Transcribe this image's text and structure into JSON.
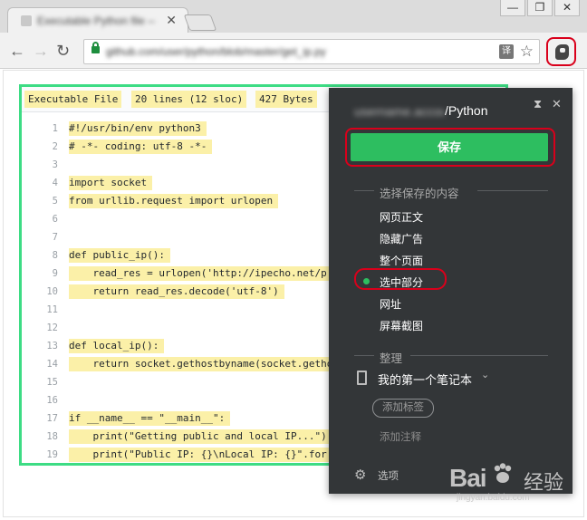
{
  "browser": {
    "tab_title": "Executable Python file — GitHub",
    "tab_close": "✕",
    "window_buttons": [
      "—",
      "❐",
      "✕"
    ],
    "nav": {
      "back": "←",
      "forward": "→",
      "reload": "↻"
    },
    "url": "github.com/user/python/blob/master/get_ip.py",
    "translate_icon": "译",
    "star_icon": "☆"
  },
  "code_view": {
    "meta": [
      "Executable File",
      "20 lines (12 sloc)",
      "427 Bytes"
    ],
    "lines": [
      {
        "n": "1",
        "text": "#!/usr/bin/env python3"
      },
      {
        "n": "2",
        "text": "# -*- coding: utf-8 -*-"
      },
      {
        "n": "3",
        "text": ""
      },
      {
        "n": "4",
        "text": "import socket"
      },
      {
        "n": "5",
        "text": "from urllib.request import urlopen"
      },
      {
        "n": "6",
        "text": ""
      },
      {
        "n": "7",
        "text": ""
      },
      {
        "n": "8",
        "text": "def public_ip():"
      },
      {
        "n": "9",
        "text": "    read_res = urlopen('http://ipecho.net/p"
      },
      {
        "n": "10",
        "text": "    return read_res.decode('utf-8')"
      },
      {
        "n": "11",
        "text": ""
      },
      {
        "n": "12",
        "text": ""
      },
      {
        "n": "13",
        "text": "def local_ip():"
      },
      {
        "n": "14",
        "text": "    return socket.gethostbyname(socket.getho"
      },
      {
        "n": "15",
        "text": ""
      },
      {
        "n": "16",
        "text": ""
      },
      {
        "n": "17",
        "text": "if __name__ == \"__main__\":"
      },
      {
        "n": "18",
        "text": "    print(\"Getting public and local IP...\")"
      },
      {
        "n": "19",
        "text": "    print(\"Public IP: {}\\nLocal IP: {}\".for"
      }
    ]
  },
  "clipper": {
    "account_blurred": "username.account",
    "path_suffix": "/Python",
    "collapse_icon": "⧗",
    "close_icon": "✕",
    "save_label": "保存",
    "content_section": "选择保存的内容",
    "options": [
      "网页正文",
      "隐藏广告",
      "整个页面",
      "选中部分",
      "网址",
      "屏幕截图"
    ],
    "selected_option": "选中部分",
    "organize_section": "整理",
    "notebook": "我的第一个笔记本",
    "notebook_chevron": "⌄",
    "add_tag": "添加标签",
    "add_note": "添加注释",
    "settings": "选项",
    "accent_color": "#2dbe60",
    "highlight_color": "#d9001b"
  },
  "watermark": {
    "brand": "Bai",
    "brand2": "经验",
    "url": "jingyan.baidu.com"
  }
}
